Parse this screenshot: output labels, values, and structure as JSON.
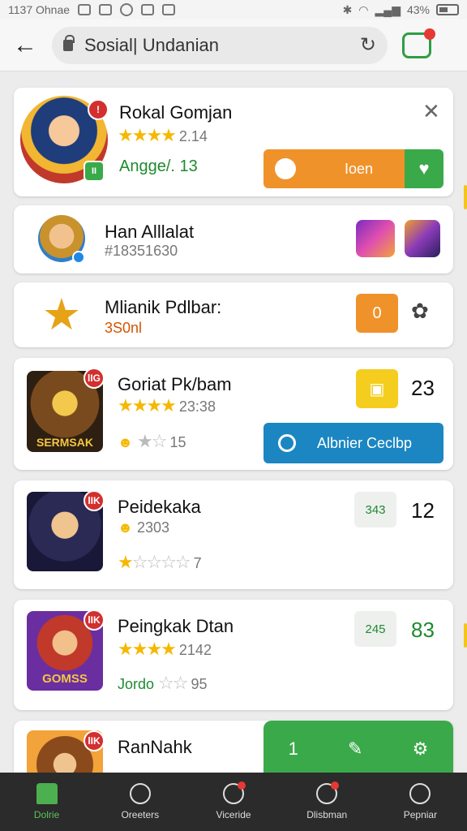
{
  "status": {
    "time": "1137 Ohnae",
    "battery": "43%"
  },
  "search": {
    "text": "Sosial| Undanian"
  },
  "cards": [
    {
      "title": "Rokal Gomjan",
      "rating_text": "2.14",
      "stars": 4,
      "meta": "Angge/. 13",
      "badge": "!",
      "join_label": "Ioen"
    },
    {
      "title": "Han Alllalat",
      "meta": "#18351630"
    },
    {
      "title": "Mlianik Pdlbar:",
      "meta": "3S0nl",
      "btn_label": "0"
    },
    {
      "title": "Goriat Pk/bam",
      "rating_text": "23:38",
      "stars": 4,
      "meta2": "15",
      "badge": "lIG",
      "thumb_caption": "SERMSAK",
      "count": "23",
      "action_label": "Albnier Ceclbp"
    },
    {
      "title": "Peidekaka",
      "meta": "2303",
      "meta2": "7",
      "badge": "lIK",
      "score": "343",
      "count": "12"
    },
    {
      "title": "Peingkak Dtan",
      "rating_text": "2142",
      "stars": 4,
      "meta": "Jordo",
      "meta2": "95",
      "badge": "lIK",
      "thumb_caption": "GOMSS",
      "score": "245",
      "count": "83"
    },
    {
      "title": "RanNahk",
      "badge": "lIK",
      "panel_num": "1"
    }
  ],
  "nav": [
    {
      "label": "Dolrie"
    },
    {
      "label": "Oreeters"
    },
    {
      "label": "Viceride"
    },
    {
      "label": "Dlisbman"
    },
    {
      "label": "Pepniar"
    }
  ],
  "colors": {
    "accent_green": "#3aa94a",
    "orange": "#f0922a",
    "blue": "#1b86c2",
    "badge_red": "#d32f2f"
  }
}
